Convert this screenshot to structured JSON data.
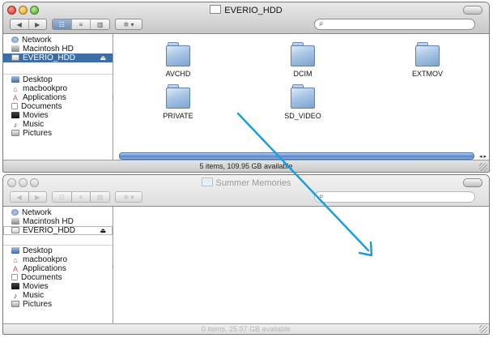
{
  "colors": {
    "selection": "#3d6ea8",
    "arrow": "#1a9ee0"
  },
  "window1": {
    "title": "EVERIO_HDD",
    "toolbar": {
      "nav": [
        "◀",
        "▶"
      ],
      "views": [
        "☷",
        "≡",
        "▥"
      ],
      "action": "✲ ▾",
      "search_icon": "⌕"
    },
    "sidebar": {
      "devices": [
        {
          "label": "Network",
          "icon": "network-icon"
        },
        {
          "label": "Macintosh HD",
          "icon": "hard-disk-icon"
        },
        {
          "label": "EVERIO_HDD",
          "icon": "external-drive-icon",
          "eject": "⏏",
          "selected": true
        }
      ],
      "places": [
        {
          "label": "Desktop",
          "icon": "desktop-icon"
        },
        {
          "label": "macbookpro",
          "icon": "home-icon"
        },
        {
          "label": "Applications",
          "icon": "applications-icon"
        },
        {
          "label": "Documents",
          "icon": "documents-icon"
        },
        {
          "label": "Movies",
          "icon": "movies-icon"
        },
        {
          "label": "Music",
          "icon": "music-icon"
        },
        {
          "label": "Pictures",
          "icon": "pictures-icon"
        }
      ]
    },
    "folders": [
      "AVCHD",
      "DCIM",
      "EXTMOV",
      "PRIVATE",
      "SD_VIDEO"
    ],
    "scroll_arrows": "◂ ▸",
    "status": "5 items, 109.95 GB available"
  },
  "window2": {
    "title": "Summer Memories",
    "toolbar": {
      "nav": [
        "◀",
        "▶"
      ],
      "views": [
        "☷",
        "≡",
        "▥"
      ],
      "action": "✲ ▾",
      "search_icon": "⌕"
    },
    "sidebar": {
      "devices": [
        {
          "label": "Network",
          "icon": "network-icon"
        },
        {
          "label": "Macintosh HD",
          "icon": "hard-disk-icon"
        },
        {
          "label": "EVERIO_HDD",
          "icon": "external-drive-icon",
          "eject": "⏏"
        }
      ],
      "places": [
        {
          "label": "Desktop",
          "icon": "desktop-icon"
        },
        {
          "label": "macbookpro",
          "icon": "home-icon"
        },
        {
          "label": "Applications",
          "icon": "applications-icon"
        },
        {
          "label": "Documents",
          "icon": "documents-icon"
        },
        {
          "label": "Movies",
          "icon": "movies-icon"
        },
        {
          "label": "Music",
          "icon": "music-icon"
        },
        {
          "label": "Pictures",
          "icon": "pictures-icon"
        }
      ]
    },
    "status": "0 items, 25.97 GB available"
  },
  "annotation": {
    "icon": "drag-arrow-icon"
  }
}
